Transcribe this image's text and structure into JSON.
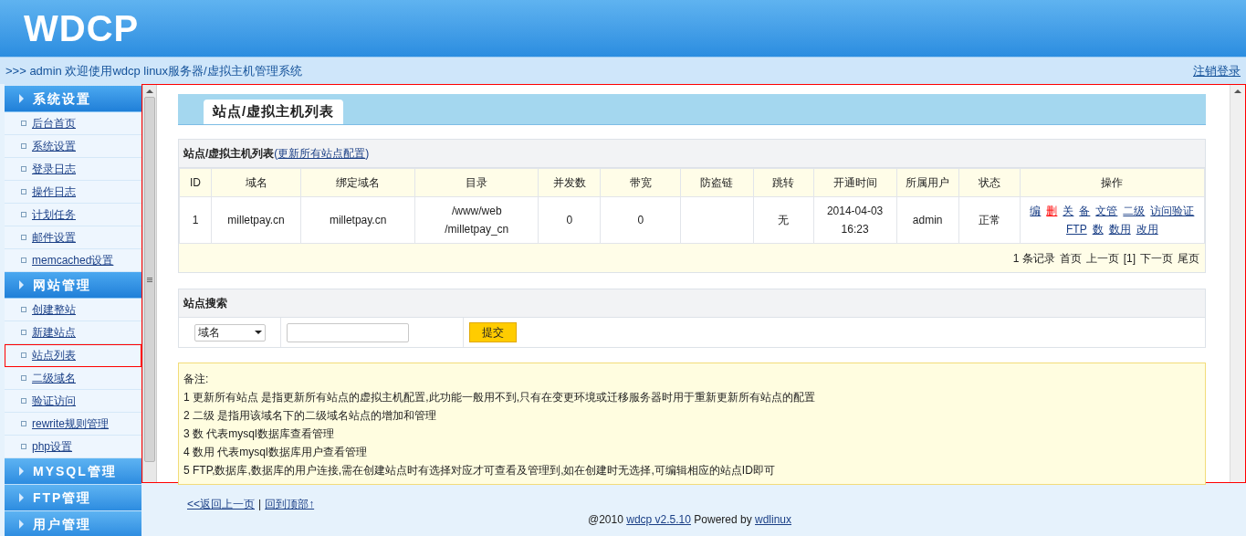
{
  "header": {
    "logo": "WDCP"
  },
  "topbar": {
    "welcome": ">>> admin 欢迎使用wdcp linux服务器/虚拟主机管理系统",
    "logout": "注销登录"
  },
  "sidebar": [
    {
      "title": "系统设置",
      "expanded": true,
      "items": [
        {
          "label": "后台首页",
          "selected": false
        },
        {
          "label": "系统设置",
          "selected": false
        },
        {
          "label": "登录日志",
          "selected": false
        },
        {
          "label": "操作日志",
          "selected": false
        },
        {
          "label": "计划任务",
          "selected": false
        },
        {
          "label": "邮件设置",
          "selected": false
        },
        {
          "label": "memcached设置",
          "selected": false
        }
      ]
    },
    {
      "title": "网站管理",
      "expanded": true,
      "items": [
        {
          "label": "创建整站",
          "selected": false
        },
        {
          "label": "新建站点",
          "selected": false
        },
        {
          "label": "站点列表",
          "selected": true
        },
        {
          "label": "二级域名",
          "selected": false
        },
        {
          "label": "验证访问",
          "selected": false
        },
        {
          "label": "rewrite规则管理",
          "selected": false
        },
        {
          "label": "php设置",
          "selected": false
        }
      ]
    },
    {
      "title": "MYSQL管理",
      "expanded": false
    },
    {
      "title": "FTP管理",
      "expanded": false
    },
    {
      "title": "用户管理",
      "expanded": false
    }
  ],
  "tab": {
    "label": "站点/虚拟主机列表"
  },
  "list_section": {
    "title": "站点/虚拟主机列表",
    "open": "(",
    "link": "更新所有站点配置",
    "close": ")"
  },
  "table": {
    "columns": [
      "ID",
      "域名",
      "绑定域名",
      "目录",
      "并发数",
      "带宽",
      "防盗链",
      "跳转",
      "开通时间",
      "所属用户",
      "状态",
      "操作"
    ],
    "rows": [
      {
        "cells": [
          "1",
          "milletpay.cn",
          "milletpay.cn",
          "/www/web\n/milletpay_cn",
          "0",
          "0",
          "",
          "无",
          "2014-04-03\n16:23",
          "admin",
          "正常"
        ],
        "actions": [
          {
            "label": "编",
            "kind": "link"
          },
          {
            "label": "删",
            "kind": "danger"
          },
          {
            "label": "关",
            "kind": "link"
          },
          {
            "label": "备",
            "kind": "link"
          },
          {
            "label": "文管",
            "kind": "link"
          },
          {
            "label": "二级",
            "kind": "link"
          },
          {
            "label": "访问验证",
            "kind": "link"
          },
          {
            "label": "FTP",
            "kind": "link"
          },
          {
            "label": "数",
            "kind": "link"
          },
          {
            "label": "数用",
            "kind": "link"
          },
          {
            "label": "改用",
            "kind": "link"
          }
        ]
      }
    ]
  },
  "pager": [
    "1 条记录",
    "首页",
    "上一页",
    "[1]",
    "下一页",
    "尾页"
  ],
  "search": {
    "title": "站点搜索",
    "select": "域名",
    "button": "提交"
  },
  "notes": {
    "title": "备注:",
    "lines": [
      "1 更新所有站点 是指更新所有站点的虚拟主机配置,此功能一般用不到,只有在变更环境或迁移服务器时用于重新更新所有站点的配置",
      "2 二级 是指用该域名下的二级域名站点的增加和管理",
      "3 数 代表mysql数据库查看管理",
      "4 数用 代表mysql数据库用户查看管理",
      "5 FTP,数据库,数据库的用户连接,需在创建站点时有选择对应才可查看及管理到,如在创建时无选择,可编辑相应的站点ID即可"
    ]
  },
  "footer": {
    "back": "<<返回上一页",
    "separator": "|",
    "top": "回到顶部↑",
    "copyright_prefix": "@2010",
    "version_link": "wdcp v2.5.10",
    "powered": "Powered by",
    "vendor_link": "wdlinux"
  }
}
